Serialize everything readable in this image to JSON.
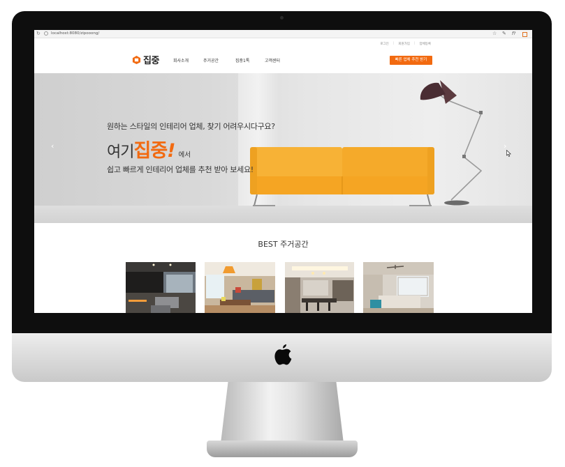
{
  "browser": {
    "url": "localhost:8080/zipooong/"
  },
  "utility_nav": {
    "items": [
      "로그인",
      "회원가입",
      "업체등록"
    ]
  },
  "logo": {
    "text": "집중"
  },
  "main_nav": {
    "items": [
      "회사소개",
      "주거공간",
      "집중1톡",
      "고객센터"
    ]
  },
  "cta": {
    "label": "빠른 업체 추천 받기"
  },
  "hero": {
    "line1": "원하는 스타일의 인테리어 업체, 찾기 어려우시다구요?",
    "headline_a": "여기",
    "headline_b": "집중",
    "headline_c": "!",
    "headline_d": "에서",
    "line3": "쉽고 빠르게 인테리어 업체를 추천 받아 보세요!",
    "arrow_left": "‹",
    "arrow_right": "›"
  },
  "best": {
    "title": "BEST 주거공간"
  },
  "colors": {
    "accent": "#f26a10",
    "sofa": "#f5a623",
    "bezel": "#0e0e0e"
  },
  "icons": [
    "reload-icon",
    "info-icon",
    "star-icon",
    "pin-icon",
    "extension-icon",
    "apple-logo-icon",
    "logo-mark-icon",
    "cursor-icon"
  ]
}
